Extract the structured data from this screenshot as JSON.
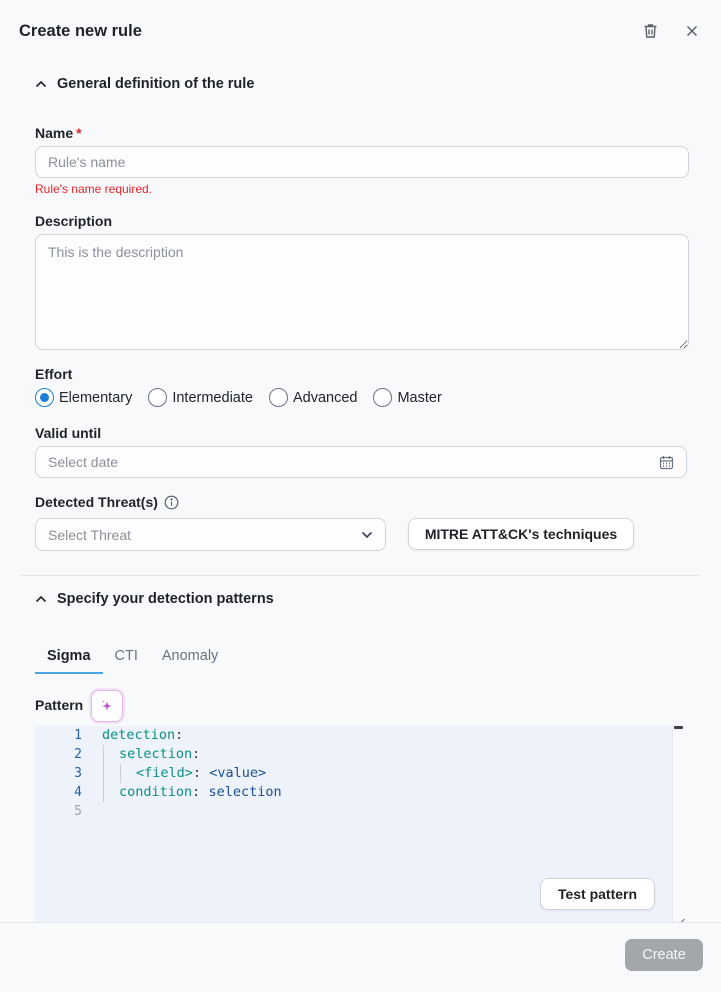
{
  "header": {
    "title": "Create new rule",
    "icons": {
      "delete": "trash-icon",
      "close": "close-icon"
    }
  },
  "general_section": {
    "title": "General definition of the rule",
    "name": {
      "label": "Name",
      "required_mark": "*",
      "placeholder": "Rule's name",
      "value": "",
      "error": "Rule's name required."
    },
    "description": {
      "label": "Description",
      "placeholder": "This is the description",
      "value": ""
    },
    "effort": {
      "label": "Effort",
      "options": [
        "Elementary",
        "Intermediate",
        "Advanced",
        "Master"
      ],
      "selected": "Elementary"
    },
    "valid_until": {
      "label": "Valid until",
      "placeholder": "Select date"
    },
    "threats": {
      "label": "Detected Threat(s)",
      "placeholder": "Select Threat",
      "mitre_button": "MITRE ATT&CK's techniques"
    }
  },
  "patterns_section": {
    "title": "Specify your detection patterns",
    "tabs": [
      {
        "label": "Sigma",
        "active": true
      },
      {
        "label": "CTI",
        "active": false
      },
      {
        "label": "Anomaly",
        "active": false
      }
    ],
    "pattern_label": "Pattern",
    "line_numbers": [
      "1",
      "2",
      "3",
      "4",
      "5"
    ],
    "code": {
      "l1_key": "detection",
      "l2_key": "selection",
      "l3_key": "<field>",
      "l3_value": "<value>",
      "l4_key": "condition",
      "l4_value": "selection",
      "colon": ":"
    },
    "test_button": "Test pattern"
  },
  "footer": {
    "create_button": "Create"
  },
  "colors": {
    "accent": "#1a7fd6",
    "error": "#e5252a",
    "disabled_button": "#a3a7ac",
    "editor_bg": "#edf2fb"
  }
}
